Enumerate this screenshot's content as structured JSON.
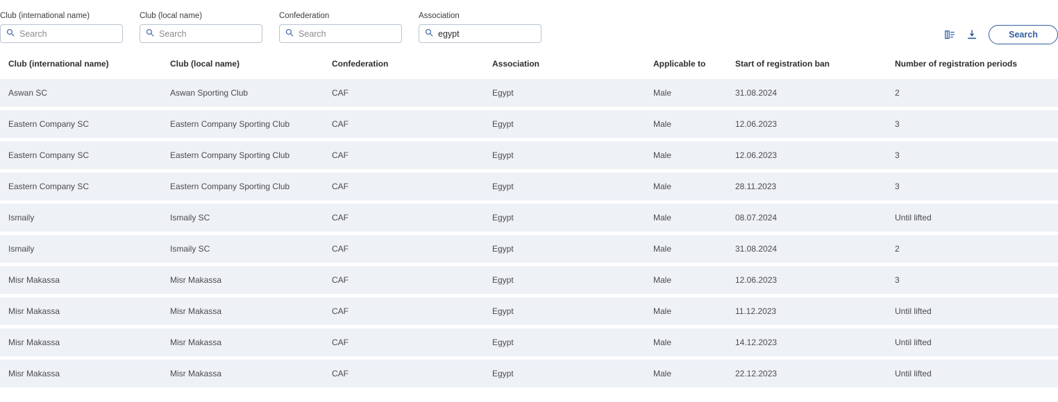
{
  "filters": {
    "fields": [
      {
        "label": "Club (international name)",
        "placeholder": "Search",
        "value": "",
        "icon": "search-icon"
      },
      {
        "label": "Club (local name)",
        "placeholder": "Search",
        "value": "",
        "icon": "search-icon"
      },
      {
        "label": "Confederation",
        "placeholder": "Search",
        "value": "",
        "icon": "search-icon"
      },
      {
        "label": "Association",
        "placeholder": "Search",
        "value": "egypt",
        "icon": "search-icon"
      }
    ]
  },
  "actions": {
    "columns_settings_icon": "table-columns-settings-icon",
    "download_icon": "download-icon",
    "search_label": "Search"
  },
  "table": {
    "columns": [
      "Club (international name)",
      "Club (local name)",
      "Confederation",
      "Association",
      "Applicable to",
      "Start of registration ban",
      "Number of registration periods"
    ],
    "rows": [
      [
        "Aswan SC",
        "Aswan Sporting Club",
        "CAF",
        "Egypt",
        "Male",
        "31.08.2024",
        "2"
      ],
      [
        "Eastern Company SC",
        "Eastern Company Sporting Club",
        "CAF",
        "Egypt",
        "Male",
        "12.06.2023",
        "3"
      ],
      [
        "Eastern Company SC",
        "Eastern Company Sporting Club",
        "CAF",
        "Egypt",
        "Male",
        "12.06.2023",
        "3"
      ],
      [
        "Eastern Company SC",
        "Eastern Company Sporting Club",
        "CAF",
        "Egypt",
        "Male",
        "28.11.2023",
        "3"
      ],
      [
        "Ismaily",
        "Ismaily SC",
        "CAF",
        "Egypt",
        "Male",
        "08.07.2024",
        "Until lifted"
      ],
      [
        "Ismaily",
        "Ismaily SC",
        "CAF",
        "Egypt",
        "Male",
        "31.08.2024",
        "2"
      ],
      [
        "Misr Makassa",
        "Misr Makassa",
        "CAF",
        "Egypt",
        "Male",
        "12.06.2023",
        "3"
      ],
      [
        "Misr Makassa",
        "Misr Makassa",
        "CAF",
        "Egypt",
        "Male",
        "11.12.2023",
        "Until lifted"
      ],
      [
        "Misr Makassa",
        "Misr Makassa",
        "CAF",
        "Egypt",
        "Male",
        "14.12.2023",
        "Until lifted"
      ],
      [
        "Misr Makassa",
        "Misr Makassa",
        "CAF",
        "Egypt",
        "Male",
        "22.12.2023",
        "Until lifted"
      ]
    ]
  },
  "colors": {
    "accent": "#2f5d9e",
    "row_background": "#eef1f6",
    "page_background": "#ffffff"
  }
}
